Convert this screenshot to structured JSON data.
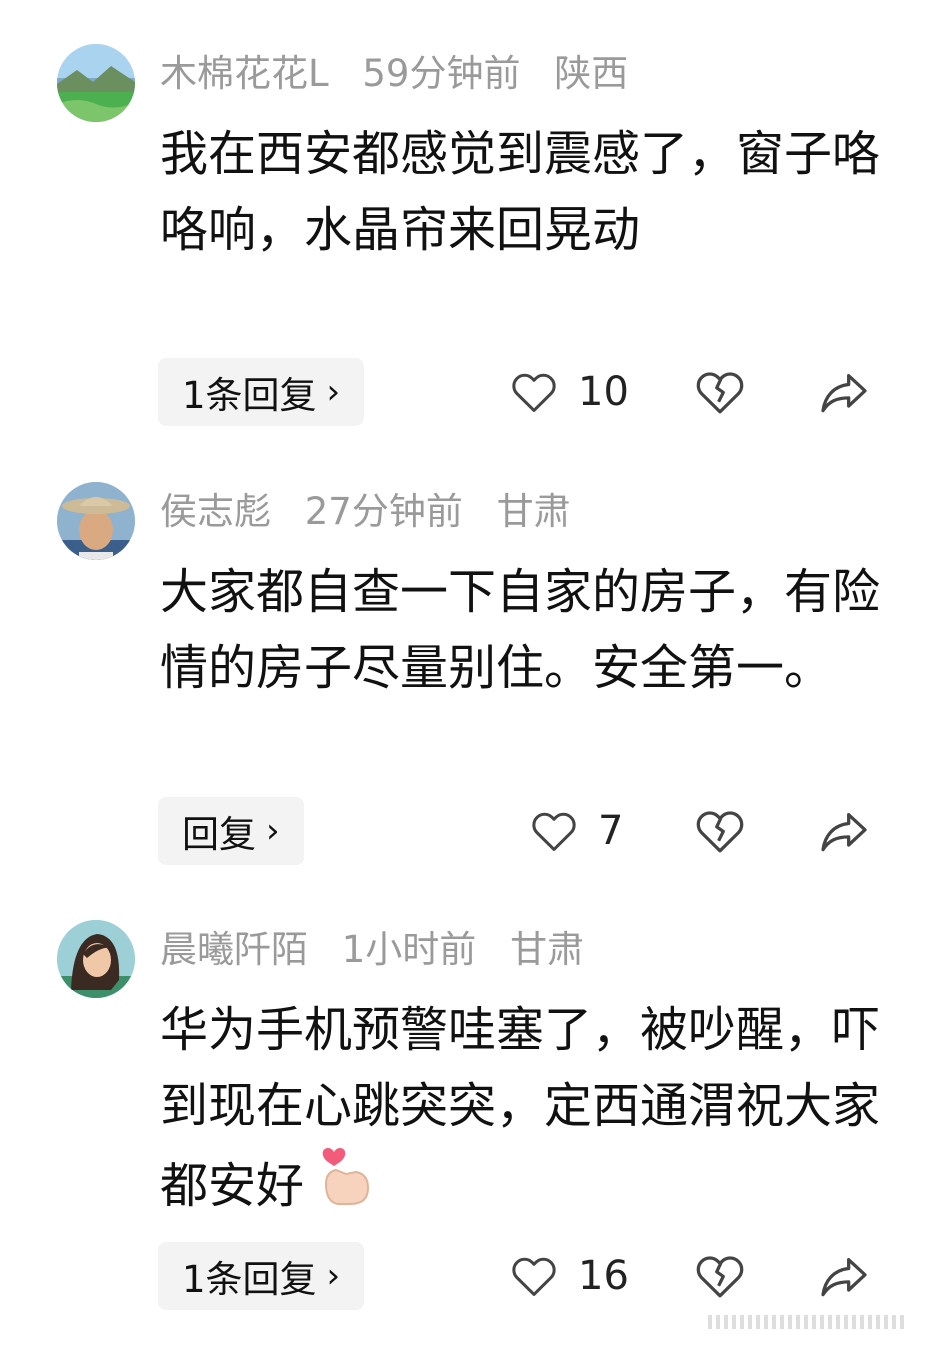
{
  "comments": [
    {
      "username": "木棉花花L",
      "time": "59分钟前",
      "location": "陕西",
      "text": "我在西安都感觉到震感了，窗子咯咯响，水晶帘来回晃动",
      "reply_label": "1条回复",
      "likes": "10",
      "avatar_icon": "landscape-avatar-icon"
    },
    {
      "username": "侯志彪",
      "time": "27分钟前",
      "location": "甘肃",
      "text": "大家都自查一下自家的房子，有险情的房子尽量别住。安全第一。",
      "reply_label": "回复",
      "likes": "7",
      "avatar_icon": "man-in-hat-avatar-icon"
    },
    {
      "username": "晨曦阡陌",
      "time": "1小时前",
      "location": "甘肃",
      "text": "华为手机预警哇塞了，被吵醒，吓到现在心跳突突，定西通渭祝大家都安好",
      "reply_label": "1条回复",
      "likes": "16",
      "avatar_icon": "woman-portrait-avatar-icon"
    }
  ],
  "colors": {
    "meta_text": "#9a9a9a",
    "reply_bg": "#f3f3f3",
    "icon_stroke": "#444444"
  }
}
